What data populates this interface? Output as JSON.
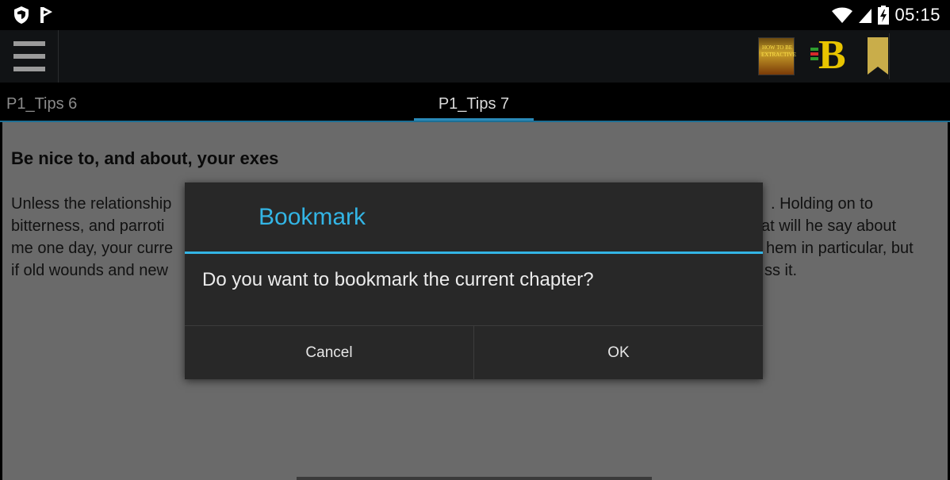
{
  "status_bar": {
    "time": "05:15",
    "icons": [
      "shield-icon",
      "flag-icon",
      "wifi-icon",
      "signal-icon",
      "battery-charging-icon"
    ]
  },
  "action_bar": {
    "menu_icon": "hamburger-icon",
    "book_cover_text": "HOW TO BE EXTRACTIVE",
    "icons": [
      "book-cover-icon",
      "fb-logo-icon",
      "bookmark-icon"
    ]
  },
  "tabs": {
    "previous": "P1_Tips 6",
    "current": "P1_Tips 7"
  },
  "article": {
    "heading": "Be nice to, and about, your exes",
    "lines": [
      {
        "left": "Unless the relationship",
        "right": ". Holding on to"
      },
      {
        "left": "bitterness, and parroti",
        "right": "at will he say about"
      },
      {
        "left": "me one day, your curre",
        "right": "hem in particular, but"
      },
      {
        "left": "if old wounds and new",
        "right": "ss it."
      }
    ]
  },
  "dialog": {
    "title": "Bookmark",
    "message": "Do you want to bookmark the current chapter?",
    "cancel_label": "Cancel",
    "ok_label": "OK"
  },
  "colors": {
    "accent": "#33b5e5",
    "tab_indicator": "#2a8ab8",
    "content_bg": "#6a6a6a",
    "dialog_bg": "#282828"
  }
}
